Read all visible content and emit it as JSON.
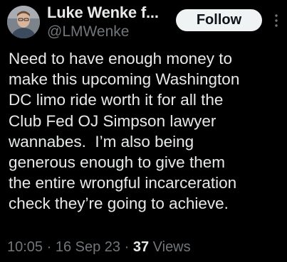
{
  "user": {
    "display_name": "Luke Wenke f...",
    "handle": "@LMWenke",
    "avatar_icon": "profile-photo"
  },
  "actions": {
    "follow_label": "Follow",
    "more_icon": "more-dots-icon"
  },
  "tweet": {
    "lines": [
      "Need to have enough money to",
      "make this upcoming Washington",
      "DC limo ride worth it for all the",
      "Club Fed OJ Simpson lawyer",
      "wannabes.  I’m also being",
      "generous enough to give them",
      "the entire wrongful incarceration",
      "check they’re going to achieve."
    ]
  },
  "meta": {
    "time": "10:05",
    "separator": " · ",
    "date": "16 Sep 23",
    "views_count": "37",
    "views_label": "Views"
  },
  "colors": {
    "background": "#000000",
    "text": "#e7e9ea",
    "secondary": "#71767b",
    "button_bg": "#eff3f4"
  }
}
